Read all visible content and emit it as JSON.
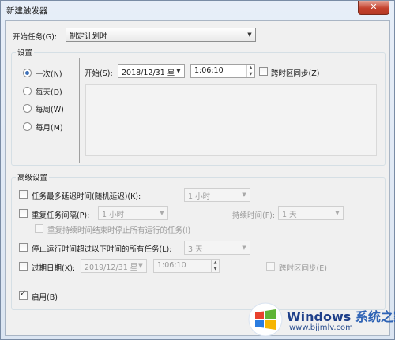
{
  "window": {
    "title": "新建触发器",
    "close_label": "✕"
  },
  "begin_task": {
    "label": "开始任务(G):",
    "value": "制定计划时"
  },
  "settings": {
    "title": "设置",
    "frequencies": [
      {
        "label": "一次(N)",
        "selected": true
      },
      {
        "label": "每天(D)",
        "selected": false
      },
      {
        "label": "每周(W)",
        "selected": false
      },
      {
        "label": "每月(M)",
        "selected": false
      }
    ],
    "start_label": "开始(S):",
    "start_date": "2018/12/31 星",
    "start_time": "1:06:10",
    "sync_timezone_label": "跨时区同步(Z)"
  },
  "advanced": {
    "title": "高级设置",
    "delay": {
      "label": "任务最多延迟时间(随机延迟)(K):",
      "value": "1 小时",
      "checked": false
    },
    "repeat": {
      "label": "重复任务间隔(P):",
      "value": "1 小时",
      "checked": false
    },
    "duration": {
      "label": "持续时间(F):",
      "value": "1 天"
    },
    "stop_running": {
      "label": "重复持续时间结束时停止所有运行的任务(I)",
      "checked": false
    },
    "stop_longer": {
      "label": "停止运行时间超过以下时间的所有任务(L):",
      "value": "3 天",
      "checked": false
    },
    "expire": {
      "label": "过期日期(X):",
      "date": "2019/12/31 星",
      "time": "1:06:10",
      "checked": false
    },
    "expire_sync_label": "跨时区同步(E)",
    "enabled": {
      "label": "启用(B)",
      "checked": true
    }
  },
  "watermark": {
    "brand": "Windows",
    "brand_cn": "系统之家",
    "url": "www.bjjmlv.com"
  }
}
